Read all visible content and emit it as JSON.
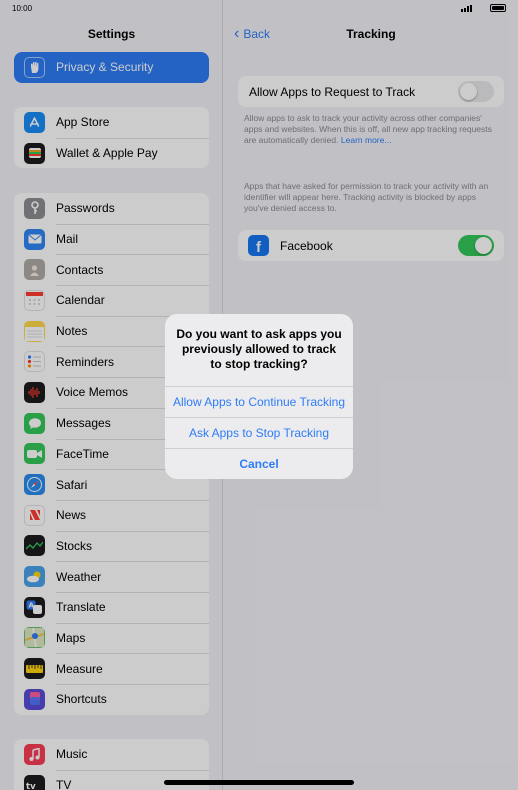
{
  "status_bar": {
    "time": "10:00"
  },
  "sidebar": {
    "title": "Settings",
    "selected_item": {
      "label": "Privacy & Security",
      "icon": "hand-icon",
      "color": "#2e7cf6"
    },
    "group1": [
      {
        "label": "App Store",
        "icon": "app-store-icon",
        "color": "#1a8cf5"
      },
      {
        "label": "Wallet & Apple Pay",
        "icon": "wallet-icon",
        "color": "#1c1c1e"
      }
    ],
    "group2": [
      {
        "label": "Passwords",
        "icon": "key-icon",
        "color": "#8e8e93"
      },
      {
        "label": "Mail",
        "icon": "mail-icon",
        "color": "#2f86f6"
      },
      {
        "label": "Contacts",
        "icon": "contacts-icon",
        "color": "#b0aba4"
      },
      {
        "label": "Calendar",
        "icon": "calendar-icon",
        "color": "#ffffff"
      },
      {
        "label": "Notes",
        "icon": "notes-icon",
        "color": "#ffd94a"
      },
      {
        "label": "Reminders",
        "icon": "reminders-icon",
        "color": "#ffffff"
      },
      {
        "label": "Voice Memos",
        "icon": "voice-memos-icon",
        "color": "#1c1c1e"
      },
      {
        "label": "Messages",
        "icon": "messages-icon",
        "color": "#34c759"
      },
      {
        "label": "FaceTime",
        "icon": "facetime-icon",
        "color": "#34c759"
      },
      {
        "label": "Safari",
        "icon": "safari-icon",
        "color": "#2a8cf0"
      },
      {
        "label": "News",
        "icon": "news-icon",
        "color": "#ffffff"
      },
      {
        "label": "Stocks",
        "icon": "stocks-icon",
        "color": "#1c1c1e"
      },
      {
        "label": "Weather",
        "icon": "weather-icon",
        "color": "#4aa3ec"
      },
      {
        "label": "Translate",
        "icon": "translate-icon",
        "color": "#1c1c1e"
      },
      {
        "label": "Maps",
        "icon": "maps-icon",
        "color": "#6cc070"
      },
      {
        "label": "Measure",
        "icon": "measure-icon",
        "color": "#1c1c1e"
      },
      {
        "label": "Shortcuts",
        "icon": "shortcuts-icon",
        "color": "#5b4ad8"
      }
    ],
    "group3": [
      {
        "label": "Music",
        "icon": "music-icon",
        "color": "#fa3c55"
      },
      {
        "label": "TV",
        "icon": "tv-icon",
        "color": "#1c1c1e"
      }
    ]
  },
  "detail": {
    "back_label": "Back",
    "title": "Tracking",
    "allow_request_label": "Allow Apps to Request to Track",
    "allow_request_state": "off",
    "allow_footnote": "Allow apps to ask to track your activity across other companies' apps and websites. When this is off, all new app tracking requests are automatically denied.",
    "learn_more": "Learn more...",
    "apps_footnote": "Apps that have asked for permission to track your activity with an identifier will appear here. Tracking activity is blocked by apps you've denied access to.",
    "app_name": "Facebook",
    "app_icon": "facebook-icon",
    "app_state": "on"
  },
  "alert": {
    "message": "Do you want to ask apps you previously allowed to track to stop tracking?",
    "button_continue": "Allow Apps to Continue Tracking",
    "button_stop": "Ask Apps to Stop Tracking",
    "button_cancel": "Cancel"
  },
  "colors": {
    "accent": "#2e7cf6",
    "toggle_on": "#34c759"
  }
}
